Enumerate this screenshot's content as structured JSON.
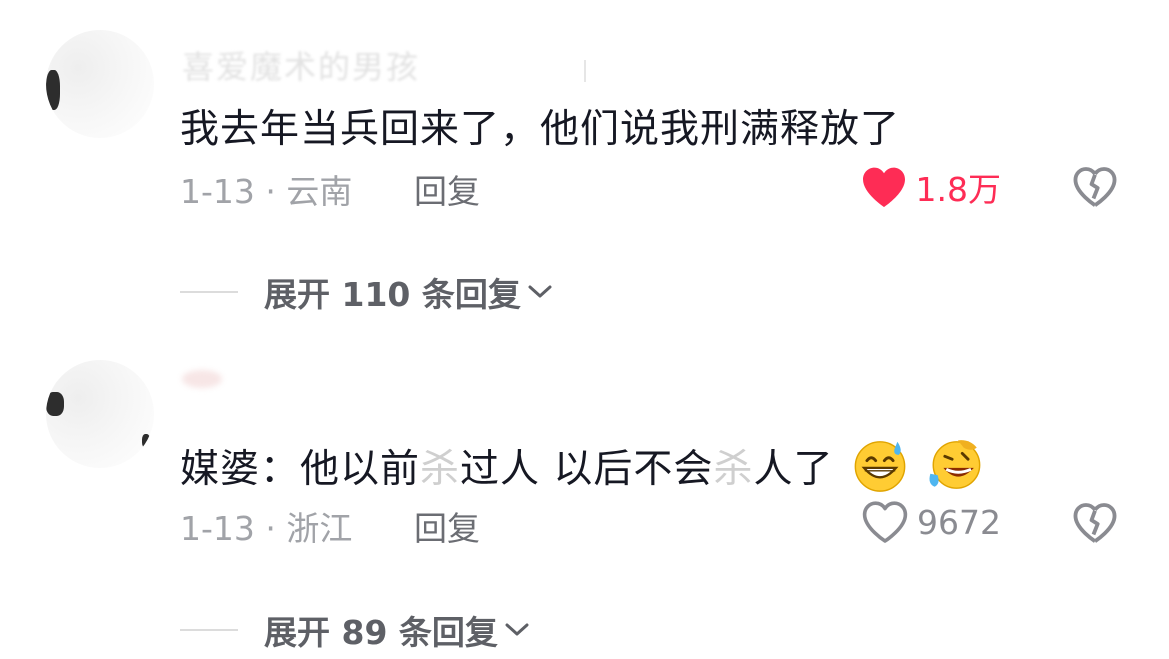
{
  "colors": {
    "text_primary": "#161823",
    "text_meta": "#a1a3a8",
    "liked_red": "#fe2c55",
    "icon_gray": "#8a8b91"
  },
  "comments": [
    {
      "username": "喜爱魔术的男孩",
      "text_main": "我去年当兵回来了，他们说我刑满释放了",
      "date_location": "1-13 · 云南",
      "reply_label": "回复",
      "like_count": "1.8万",
      "liked": true,
      "like_icon": "heart-filled-icon",
      "dislike_icon": "broken-heart-icon",
      "expand_label": "展开 110 条回复",
      "expand_icon": "chevron-down-icon"
    },
    {
      "text_prefix": "媒婆：他以前",
      "text_faded_1": "杀",
      "text_middle": "过人 以后不会",
      "text_faded_2": "杀",
      "text_suffix": "人了",
      "emojis": [
        "grinning-sweat-emoji",
        "rolling-laughing-emoji"
      ],
      "date_location": "1-13 · 浙江",
      "reply_label": "回复",
      "like_count": "9672",
      "liked": false,
      "like_icon": "heart-outline-icon",
      "dislike_icon": "broken-heart-icon",
      "expand_label": "展开 89 条回复",
      "expand_icon": "chevron-down-icon"
    }
  ]
}
